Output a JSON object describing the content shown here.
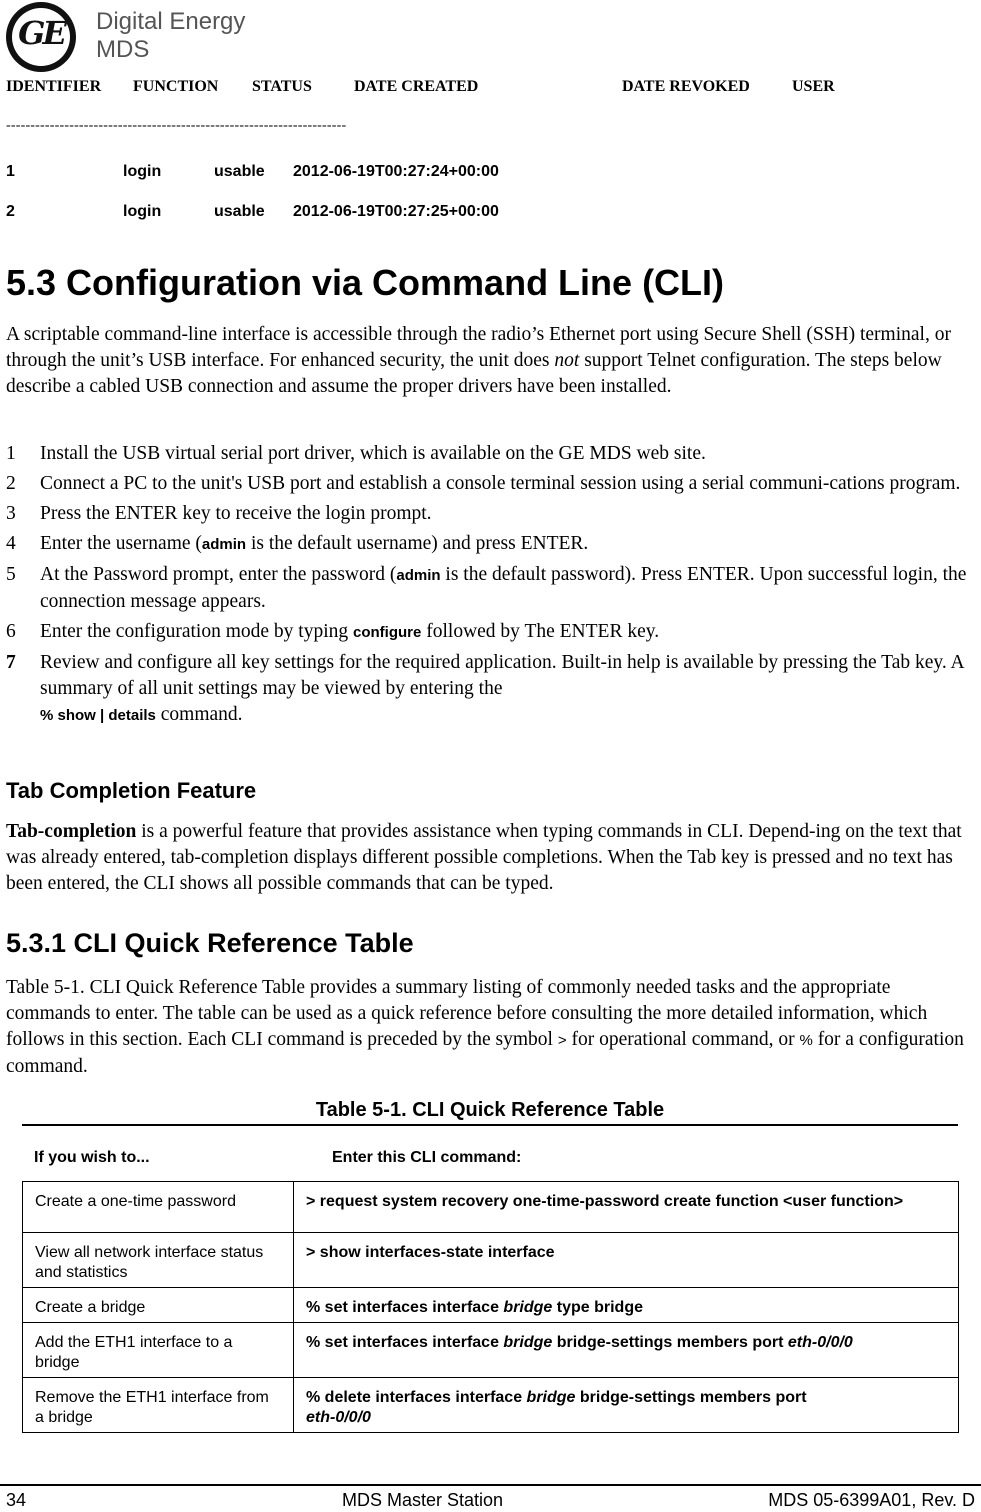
{
  "logo": {
    "monogram": "GE",
    "line1": "Digital Energy",
    "line2": "MDS"
  },
  "otp_listing": {
    "headers": [
      "IDENTIFIER",
      "FUNCTION",
      "STATUS",
      "DATE CREATED",
      "DATE REVOKED",
      "USER"
    ],
    "separator": "----------------------------------------------------------------------",
    "rows": [
      {
        "identifier": "1",
        "function": "login",
        "status": "usable",
        "date_created": "2012-06-19T00:27:24+00:00"
      },
      {
        "identifier": "2",
        "function": "login",
        "status": "usable",
        "date_created": "2012-06-19T00:27:25+00:00"
      }
    ]
  },
  "section": {
    "title": "5.3 Configuration via Command Line (CLI)",
    "intro": {
      "p1": "A scriptable command-line interface is accessible through the radio’s Ethernet port using Secure Shell (SSH) terminal, or through the unit’s USB interface. For enhanced security, the unit does ",
      "em": "not",
      "p2": " support Telnet configuration. The steps below describe a cabled USB connection and assume the proper drivers have been installed."
    },
    "steps": [
      {
        "num": "1",
        "text": "Install the USB virtual serial port driver, which is available on the GE MDS web site."
      },
      {
        "num": "2",
        "text": "Connect a PC to the unit's USB port and establish a console terminal session using a serial communi-cations program."
      },
      {
        "num": "3",
        "text": "Press the ENTER key to receive the login prompt."
      },
      {
        "num": "4",
        "pre": "Enter the username (",
        "code": "admin",
        "post": " is the default username) and press ENTER."
      },
      {
        "num": "5",
        "pre": "At the Password prompt, enter the password (",
        "code": "admin",
        "post": " is the default password). Press ENTER. Upon successful login, the connection message appears."
      },
      {
        "num": "6",
        "pre": "Enter the configuration mode by typing ",
        "code": "configure",
        "post": " followed by The ENTER key."
      },
      {
        "num": "7",
        "pre": "Review and configure all key settings for the required application. Built-in help is available by pressing the Tab key. A summary of all unit settings may be viewed by entering the",
        "code": "% show | details",
        "post": " command."
      }
    ]
  },
  "tab_completion": {
    "heading": "Tab Completion Feature",
    "bold_lead": "Tab-completion",
    "text": " is a powerful feature that provides assistance when typing commands in CLI. Depend-ing on the text that was already entered, tab-completion displays different possible completions. When the Tab key is pressed and no text has been entered, the CLI shows all possible commands that can be typed."
  },
  "quick_ref": {
    "heading": "5.3.1 CLI Quick Reference Table",
    "intro_p1": "Table 5-1. CLI Quick Reference Table provides a summary listing of commonly needed tasks and the appropriate commands to enter. The table can be used as a quick reference before consulting the more detailed information, which follows in this section. Each CLI command is preceded by the symbol ",
    "symbol_op": ">",
    "intro_p2": " for operational command, or ",
    "symbol_cfg": "%",
    "intro_p3": " for a configuration command.",
    "table_caption": "Table 5-1. CLI Quick Reference Table",
    "col_task": "If you wish to...",
    "col_cmd": "Enter this CLI command:",
    "rows": [
      {
        "task": "Create a one-time password",
        "cmd_a": "> request system recovery one-time-password create function <user function>",
        "cmd_em": "",
        "cmd_b": "",
        "cmd_em2": ""
      },
      {
        "task": "View all network interface status and statistics",
        "cmd_a": "> show interfaces-state interface",
        "cmd_em": "",
        "cmd_b": "",
        "cmd_em2": ""
      },
      {
        "task": "Create a bridge",
        "cmd_a": "% set interfaces interface ",
        "cmd_em": "bridge",
        "cmd_b": " type bridge",
        "cmd_em2": ""
      },
      {
        "task": "Add the ETH1 interface to a bridge",
        "cmd_a": "% set interfaces interface ",
        "cmd_em": "bridge",
        "cmd_b": " bridge-settings members port ",
        "cmd_em2": "eth-0/0/0"
      },
      {
        "task": "Remove the ETH1 interface from a bridge",
        "cmd_a": "% delete interfaces interface ",
        "cmd_em": "bridge",
        "cmd_b": " bridge-settings members port ",
        "cmd_em2": "eth-0/0/0"
      }
    ]
  },
  "footer": {
    "page_number": "34",
    "center": "MDS Master Station",
    "right": "MDS 05-6399A01, Rev. D"
  }
}
